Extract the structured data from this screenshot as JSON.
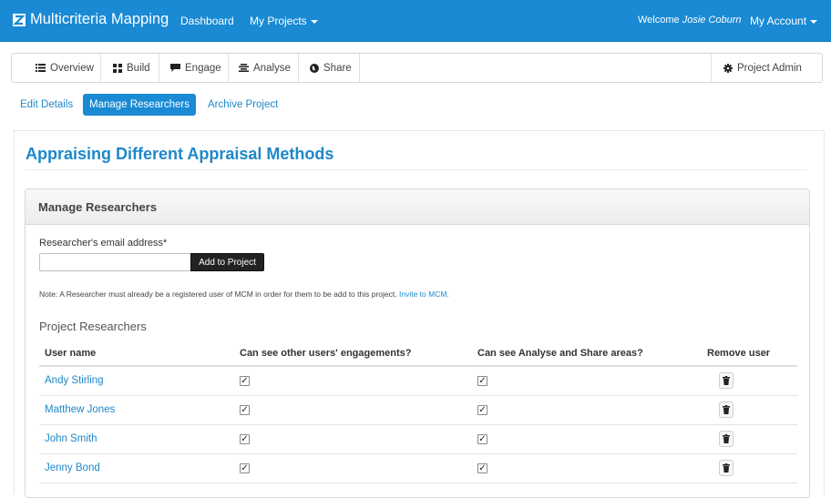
{
  "navbar": {
    "brand": "Multicriteria Mapping",
    "dashboard": "Dashboard",
    "my_projects": "My Projects",
    "welcome_prefix": "Welcome",
    "user_name": "Josie Coburn",
    "my_account": "My Account",
    "bg_color": "#1a8ad4"
  },
  "toolbar": {
    "overview": "Overview",
    "build": "Build",
    "engage": "Engage",
    "analyse": "Analyse",
    "share": "Share",
    "project_admin": "Project Admin"
  },
  "subnav": {
    "edit_details": "Edit Details",
    "manage_researchers": "Manage Researchers",
    "archive_project": "Archive Project"
  },
  "page": {
    "title": "Appraising Different Appraisal Methods"
  },
  "panel": {
    "heading": "Manage Researchers",
    "email_label": "Researcher's email address*",
    "email_value": "",
    "add_button": "Add to Project",
    "note": "Note: A Researcher must already be a registered user of MCM in order for them to be add to this project.",
    "invite_link": "Invite to MCM."
  },
  "researchers": {
    "title": "Project Researchers",
    "columns": [
      "User name",
      "Can see other users' engagements?",
      "Can see Analyse and Share areas?",
      "Remove user"
    ],
    "rows": [
      {
        "name": "Andy Stirling",
        "see_engagements": true,
        "see_analyse_share": true
      },
      {
        "name": "Matthew Jones",
        "see_engagements": true,
        "see_analyse_share": true
      },
      {
        "name": "John Smith",
        "see_engagements": true,
        "see_analyse_share": true
      },
      {
        "name": "Jenny Bond",
        "see_engagements": true,
        "see_analyse_share": true
      }
    ]
  }
}
